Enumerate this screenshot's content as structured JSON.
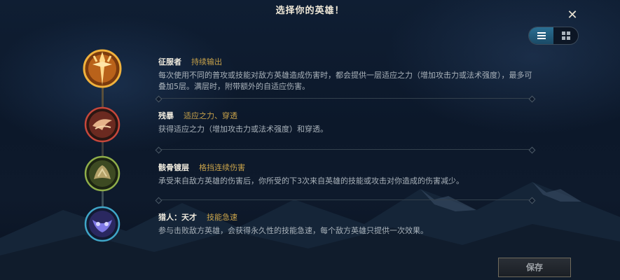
{
  "header": {
    "title": "选择你的英雄！",
    "close_icon": "✕"
  },
  "view_toggle": {
    "options": [
      "list-icon",
      "grid-icon"
    ],
    "selected": "list"
  },
  "runes": [
    {
      "name": "征服者",
      "tag": "持续输出",
      "desc": "每次使用不同的普攻或技能对敌方英雄造成伤害时，都会提供一层适应之力（增加攻击力或法术强度），最多可叠加5层。满层时，附带额外的自适应伤害。",
      "icon": "conqueror-icon",
      "color": "#e49a2c"
    },
    {
      "name": "残暴",
      "tag": "适应之力、穿透",
      "desc": "获得适应之力（增加攻击力或法术强度）和穿透。",
      "icon": "brutal-icon",
      "color": "#c6473b"
    },
    {
      "name": "骸骨镀层",
      "tag": "格挡连续伤害",
      "desc": "承受来自敌方英雄的伤害后，你所受的下3次来自英雄的技能或攻击对你造成的伤害减少。",
      "icon": "bone-plating-icon",
      "color": "#8fae4a"
    },
    {
      "name": "猎人：天才",
      "tag": "技能急速",
      "desc": "参与击败敌方英雄，会获得永久性的技能急速，每个敌方英雄只提供一次效果。",
      "icon": "ingenious-hunter-icon",
      "color": "#3fa6c8"
    }
  ],
  "footer": {
    "save_label": "保存"
  }
}
